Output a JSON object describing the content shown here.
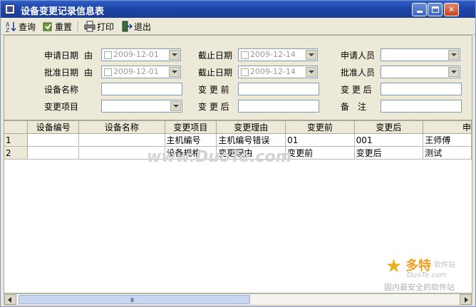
{
  "window": {
    "title": "设备变更记录信息表",
    "controls": [
      "minimize",
      "maximize",
      "close"
    ]
  },
  "toolbar": {
    "query_label": "查询",
    "reset_label": "重置",
    "print_label": "打印",
    "exit_label": "退出"
  },
  "form": {
    "apply_date_label": "申请日期",
    "from_label": "由",
    "apply_date_from": "2009-12-01",
    "apply_end_label": "截止日期",
    "apply_date_to": "2009-12-14",
    "applicant_label": "申请人员",
    "applicant_value": "",
    "approve_date_label": "批准日期",
    "from_label2": "由",
    "approve_date_from": "2009-12-01",
    "approve_end_label": "截止日期",
    "approve_date_to": "2009-12-14",
    "approver_label": "批准人员",
    "approver_value": "",
    "device_name_label": "设备名称",
    "device_name_value": "",
    "before_label": "变 更 前",
    "before_value": "",
    "after_label_r": "变 更 后",
    "after_value_r": "",
    "change_item_label": "变更项目",
    "change_item_value": "",
    "after_label": "变 更 后",
    "after_value": "",
    "remark_label": "备　注",
    "remark_value": ""
  },
  "grid": {
    "columns": [
      "",
      "设备编号",
      "设备名称",
      "变更项目",
      "变更理由",
      "变更前",
      "变更后",
      "申"
    ],
    "rows": [
      [
        "1",
        "",
        "",
        "主机编号",
        "主机编号错误",
        "01",
        "001",
        "王师傅"
      ],
      [
        "2",
        "",
        "",
        "设备规格",
        "变更理由",
        "变更前",
        "变更后",
        "测试"
      ]
    ]
  },
  "scrollbar": {
    "grip": "III"
  },
  "watermark": {
    "url": "www.DuoTe.com",
    "logo_main": "多特",
    "logo_sub": "软件站",
    "logo_url": "DuoTe.com",
    "logo_slogan": "国内最安全的软件站"
  }
}
